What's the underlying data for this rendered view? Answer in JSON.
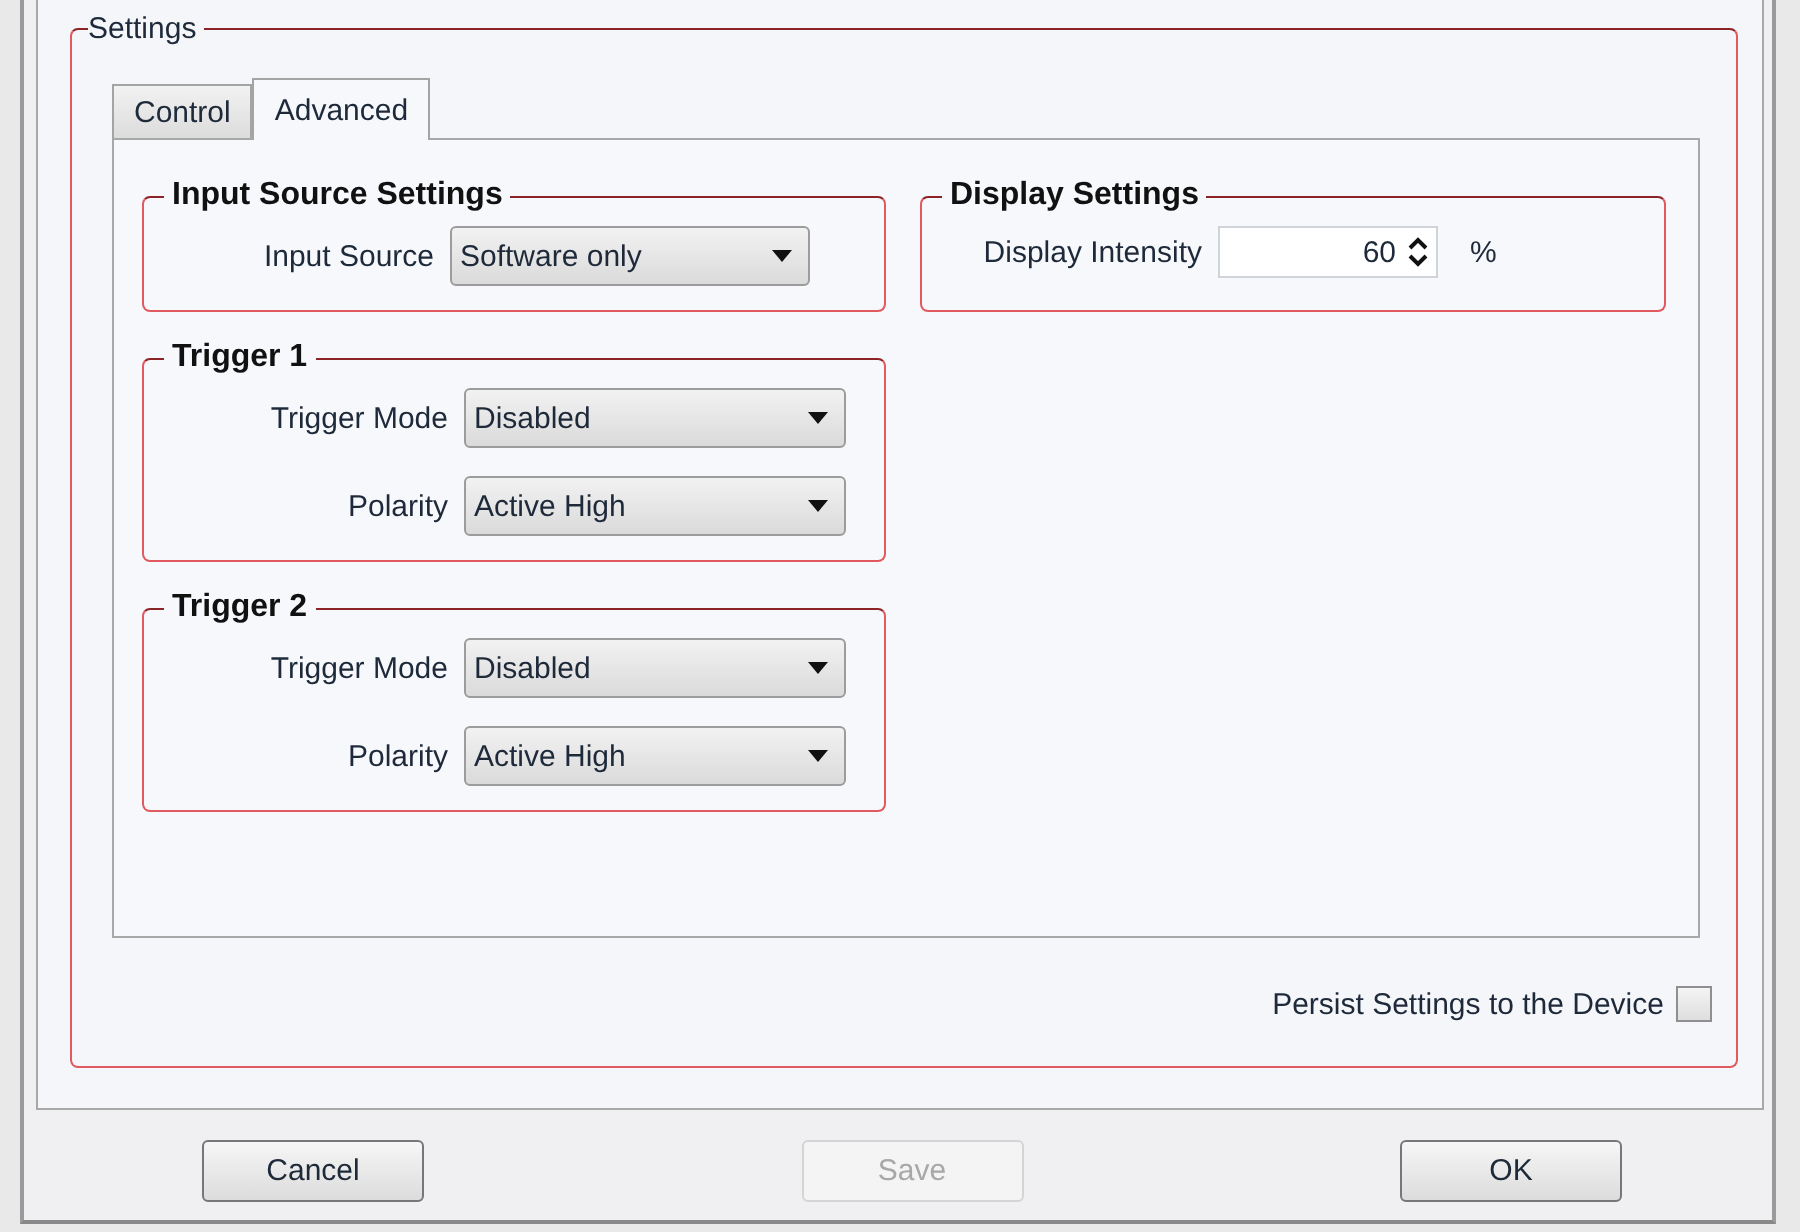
{
  "settings": {
    "title": "Settings",
    "tabs": [
      {
        "label": "Control",
        "selected": false
      },
      {
        "label": "Advanced",
        "selected": true
      }
    ],
    "groups": [
      {
        "title": "Input Source Settings",
        "fields": [
          {
            "kind": "dropdown",
            "label": "Input Source",
            "value": "Software only"
          }
        ]
      },
      {
        "title": "Display Settings",
        "fields": [
          {
            "kind": "spinner",
            "label": "Display Intensity",
            "value": "60",
            "unit": "%"
          }
        ]
      },
      {
        "title": "Trigger 1",
        "fields": [
          {
            "kind": "dropdown",
            "label": "Trigger Mode",
            "value": "Disabled"
          },
          {
            "kind": "dropdown",
            "label": "Polarity",
            "value": "Active High"
          }
        ]
      },
      {
        "title": "Trigger 2",
        "fields": [
          {
            "kind": "dropdown",
            "label": "Trigger Mode",
            "value": "Disabled"
          },
          {
            "kind": "dropdown",
            "label": "Polarity",
            "value": "Active High"
          }
        ]
      }
    ],
    "persist": {
      "label": "Persist Settings to the Device",
      "checked": false
    }
  },
  "buttons": [
    {
      "label": "Cancel",
      "disabled": false
    },
    {
      "label": "Save",
      "disabled": true
    },
    {
      "label": "OK",
      "disabled": false
    }
  ]
}
